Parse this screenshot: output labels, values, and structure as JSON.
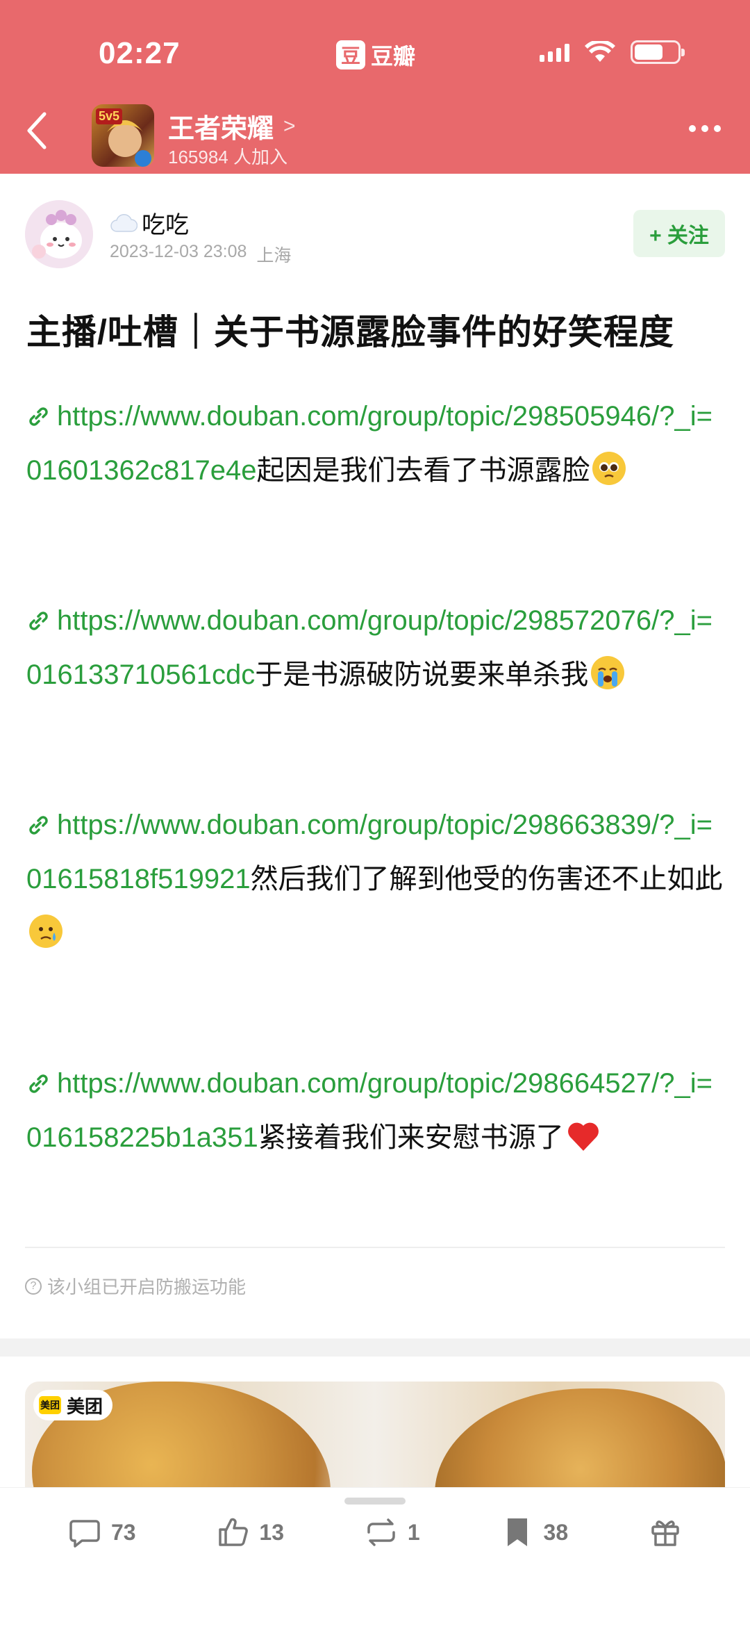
{
  "status_bar": {
    "time": "02:27",
    "app_logo": "豆",
    "app_name": "豆瓣"
  },
  "header": {
    "group_name": "王者荣耀",
    "members": "165984 人加入",
    "avatar_badge": "5v5"
  },
  "author": {
    "name": "吃吃",
    "date": "2023-12-03 23:08",
    "location": "上海",
    "follow_label": "+ 关注",
    "name_icon": "cloud-emoji"
  },
  "post": {
    "title": "主播/吐槽｜关于书源露脸事件的好笑程度",
    "paragraphs": [
      {
        "link": "https://www.douban.com/group/topic/298505946/?_i=01601362c817e4e",
        "text": "起因是我们去看了书源露脸",
        "emoji": "pleading-face"
      },
      {
        "link": "https://www.douban.com/group/topic/298572076/?_i=016133710561cdc",
        "text": "于是书源破防说要来单杀我",
        "emoji": "loudly-crying-face"
      },
      {
        "link": "https://www.douban.com/group/topic/298663839/?_i=01615818f519921",
        "text": "然后我们了解到他受的伤害还不止如此",
        "emoji": "sad-but-relieved-face"
      },
      {
        "link": "https://www.douban.com/group/topic/298664527/?_i=016158225b1a351",
        "text": "紧接着我们来安慰书源了",
        "emoji": "red-heart"
      }
    ],
    "notice": "该小组已开启防搬运功能"
  },
  "ad": {
    "brand": "美团",
    "logo_text": "美团"
  },
  "bottom_bar": {
    "comments": "73",
    "likes": "13",
    "reshares": "1",
    "collects": "38"
  },
  "colors": {
    "header_bg": "#e8696c",
    "link_green": "#2a9e3c",
    "follow_bg": "#e9f6ea"
  }
}
